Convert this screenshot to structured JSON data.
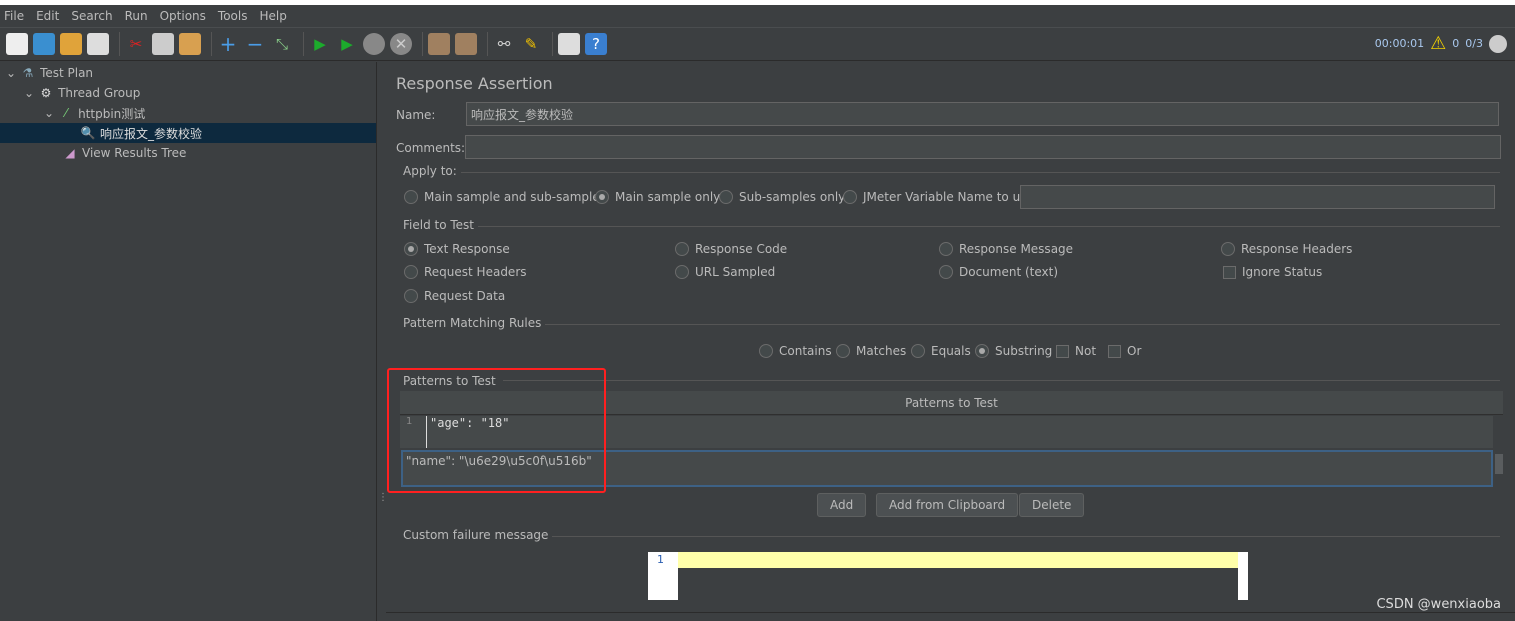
{
  "menu": [
    "File",
    "Edit",
    "Search",
    "Run",
    "Options",
    "Tools",
    "Help"
  ],
  "toolbar": {
    "icons": [
      "new-icon",
      "templates-icon",
      "open-icon",
      "save-icon",
      "cut-icon",
      "copy-icon",
      "paste-icon",
      "expand-icon",
      "collapse-icon",
      "toggle-icon",
      "start-icon",
      "start-no-pause-icon",
      "stop-icon",
      "shutdown-icon",
      "clear-icon",
      "clear-all-icon",
      "search-icon",
      "reset-search-icon",
      "function-helper-icon",
      "help-icon"
    ]
  },
  "status": {
    "timer": "00:00:01",
    "warnings": "0",
    "threads": "0/3"
  },
  "tree": [
    {
      "label": "Test Plan",
      "icon": "test-plan-icon"
    },
    {
      "label": "Thread Group",
      "icon": "gear-icon"
    },
    {
      "label": "httpbin测试",
      "icon": "pipette-icon"
    },
    {
      "label": "响应报文_参数校验",
      "icon": "assertion-icon"
    },
    {
      "label": "View Results Tree",
      "icon": "chart-icon"
    }
  ],
  "panel": {
    "title": "Response Assertion",
    "name_label": "Name:",
    "name_value": "响应报文_参数校验",
    "comments_label": "Comments:",
    "comments_value": "",
    "apply_to": {
      "label": "Apply to:",
      "options": [
        "Main sample and sub-samples",
        "Main sample only",
        "Sub-samples only",
        "JMeter Variable Name to use"
      ],
      "selected": "Main sample only",
      "var_value": ""
    },
    "field": {
      "label": "Field to Test",
      "options": [
        "Text Response",
        "Response Code",
        "Response Message",
        "Response Headers",
        "Request Headers",
        "URL Sampled",
        "Document (text)",
        "Ignore Status",
        "Request Data"
      ],
      "selected": "Text Response"
    },
    "rules": {
      "label": "Pattern Matching Rules",
      "options": [
        "Contains",
        "Matches",
        "Equals",
        "Substring"
      ],
      "selected": "Substring",
      "checks": [
        "Not",
        "Or"
      ]
    },
    "patterns": {
      "label": "Patterns to Test",
      "column": "Patterns to Test",
      "rows": [
        "\"age\": \"18\"",
        "\"name\": \"\\u6e29\\u5c0f\\u516b\""
      ],
      "line_no": "1"
    },
    "buttons": [
      "Add",
      "Add from Clipboard",
      "Delete"
    ],
    "failure": {
      "label": "Custom failure message",
      "line_no": "1",
      "value": ""
    }
  },
  "watermark": "CSDN @wenxiaoba",
  "colors": {
    "highlight": "#ff2020",
    "selection": "#0d293e",
    "editor_line": "#ffffaa"
  }
}
